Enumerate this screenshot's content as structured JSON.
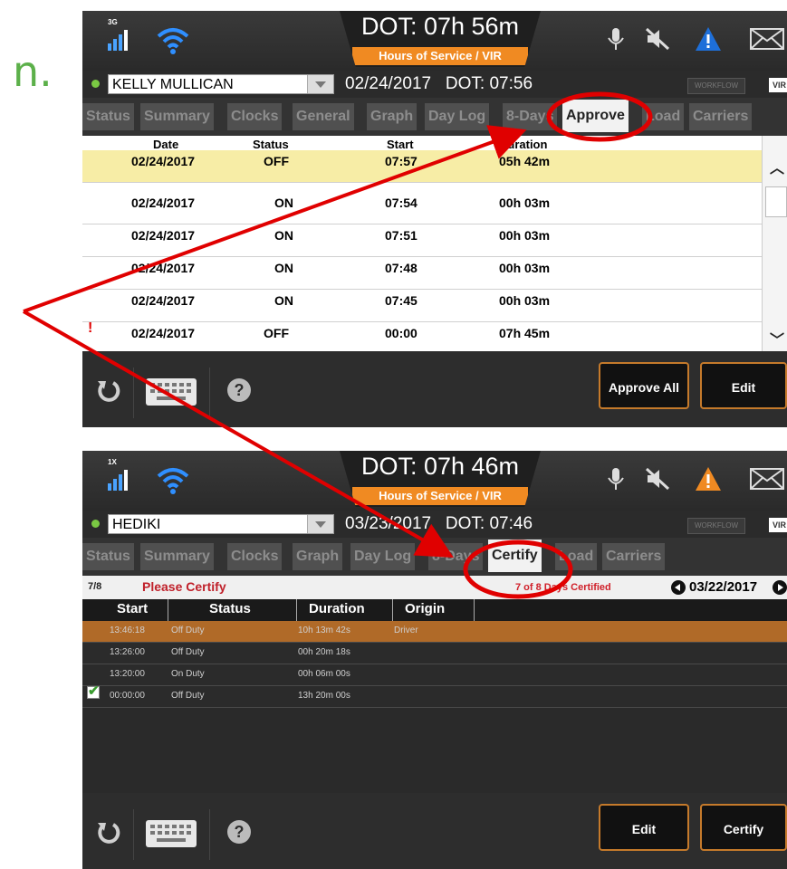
{
  "fragment": "n.",
  "screen1": {
    "network": "3G",
    "dot": "DOT: 07h 56m",
    "banner": "Hours of Service / VIR",
    "driver": "KELLY MULLICAN",
    "date_dot": "02/24/2017   DOT: 07:56",
    "workflow": "WORKFLOW",
    "vir": "VIR",
    "tabs": [
      "Status",
      "Summary",
      "Clocks",
      "General",
      "Graph",
      "Day Log",
      "8-Days",
      "Approve",
      "Load",
      "Carriers"
    ],
    "active_tab": "Approve",
    "columns": [
      "Date",
      "Status",
      "Start",
      "Duration"
    ],
    "rows": [
      {
        "date": "02/24/2017",
        "status": "OFF",
        "start": "07:57",
        "duration": "05h 42m",
        "highlight": true
      },
      {
        "date": "02/24/2017",
        "status": "ON",
        "start": "07:54",
        "duration": "00h 03m"
      },
      {
        "date": "02/24/2017",
        "status": "ON",
        "start": "07:51",
        "duration": "00h 03m"
      },
      {
        "date": "02/24/2017",
        "status": "ON",
        "start": "07:48",
        "duration": "00h 03m"
      },
      {
        "date": "02/24/2017",
        "status": "ON",
        "start": "07:45",
        "duration": "00h 03m"
      },
      {
        "date": "02/24/2017",
        "status": "OFF",
        "start": "00:00",
        "duration": "07h 45m",
        "warning": "!"
      }
    ],
    "buttons": {
      "approve_all": "Approve All",
      "edit": "Edit"
    }
  },
  "screen2": {
    "network": "1X",
    "dot": "DOT: 07h 46m",
    "banner": "Hours of Service / VIR",
    "driver": "HEDIKI",
    "date_dot": "03/23/2017   DOT: 07:46",
    "workflow": "WORKFLOW",
    "vir": "VIR",
    "tabs": [
      "Status",
      "Summary",
      "Clocks",
      "Graph",
      "Day Log",
      "8-Days",
      "Certify",
      "Load",
      "Carriers"
    ],
    "active_tab": "Certify",
    "count": "7/8",
    "please_certify": "Please Certify",
    "days_certified": "7 of 8 Days Certified",
    "current_date": "03/22/2017",
    "columns": [
      "Start",
      "Status",
      "Duration",
      "Origin"
    ],
    "rows": [
      {
        "start": "13:46:18",
        "status": "Off Duty",
        "duration": "10h 13m 42s",
        "origin": "Driver",
        "selected": true
      },
      {
        "start": "13:26:00",
        "status": "Off Duty",
        "duration": "00h 20m 18s",
        "origin": ""
      },
      {
        "start": "13:20:00",
        "status": "On Duty",
        "duration": "00h 06m 00s",
        "origin": ""
      },
      {
        "start": "00:00:00",
        "status": "Off Duty",
        "duration": "13h 20m 00s",
        "origin": "",
        "checked": true
      }
    ],
    "buttons": {
      "edit": "Edit",
      "certify": "Certify"
    }
  },
  "colors": {
    "accent_orange": "#f08a22",
    "highlight_yellow": "#f7eda6",
    "annotation_red": "#e00000",
    "selected_row": "#b06a28"
  }
}
